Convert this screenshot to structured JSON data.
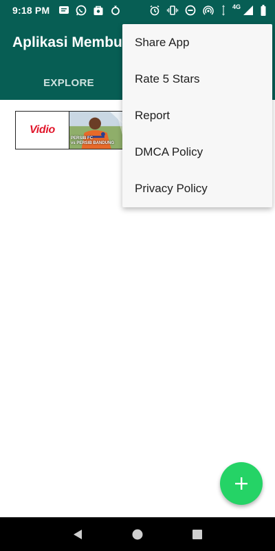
{
  "status_bar": {
    "time": "9:18 PM",
    "network_label": "4G",
    "left_icons": [
      "message-icon",
      "whatsapp-icon",
      "bag-icon",
      "recycle-icon"
    ],
    "right_icons": [
      "alarm-icon",
      "vibrate-icon",
      "do-not-disturb-icon",
      "hotspot-icon",
      "data-arrows-icon",
      "signal-icon",
      "battery-icon"
    ]
  },
  "app_bar": {
    "title": "Aplikasi Membuat Stiker",
    "tabs": [
      {
        "label": "EXPLORE"
      }
    ]
  },
  "content": {
    "card": {
      "logo_text": "Vidio",
      "thumbnail_caption_line1": "PERSIB FC",
      "thumbnail_caption_line2": "vs PERSIB BANDUNG"
    }
  },
  "overflow_menu": {
    "items": [
      {
        "label": "Share App"
      },
      {
        "label": "Rate 5 Stars"
      },
      {
        "label": "Report"
      },
      {
        "label": "DMCA Policy"
      },
      {
        "label": "Privacy Policy"
      }
    ]
  },
  "fab": {
    "icon": "plus-icon"
  },
  "nav_bar": {
    "icons": [
      "back-icon",
      "home-icon",
      "recents-icon"
    ]
  },
  "colors": {
    "primary": "#075e54",
    "accent": "#25d366",
    "menu_background": "#f7f7f7"
  }
}
